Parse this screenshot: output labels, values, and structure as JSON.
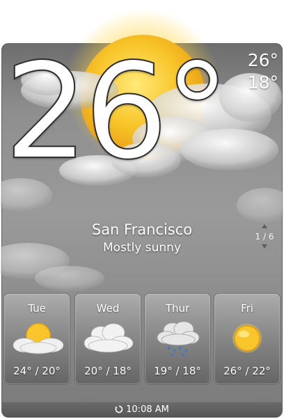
{
  "current": {
    "temperature": "26",
    "degree_symbol": "°",
    "high": "26°",
    "low": "18°",
    "city": "San Francisco",
    "condition": "Mostly sunny",
    "weather_icon": "sun-with-clouds-icon"
  },
  "pager": {
    "position": "1 / 6"
  },
  "forecast": [
    {
      "day": "Tue",
      "range": "24° / 20°",
      "icon": "partly-sunny-icon"
    },
    {
      "day": "Wed",
      "range": "20° / 18°",
      "icon": "cloudy-icon"
    },
    {
      "day": "Thur",
      "range": "19° / 18°",
      "icon": "rain-icon"
    },
    {
      "day": "Fri",
      "range": "26° / 22°",
      "icon": "sunny-icon"
    }
  ],
  "footer": {
    "time": "10:08 AM",
    "icon": "refresh-icon"
  },
  "colors": {
    "sun": "#f7c12a",
    "panel": "#8e8e8e",
    "cloud": "#e8e8e8"
  }
}
